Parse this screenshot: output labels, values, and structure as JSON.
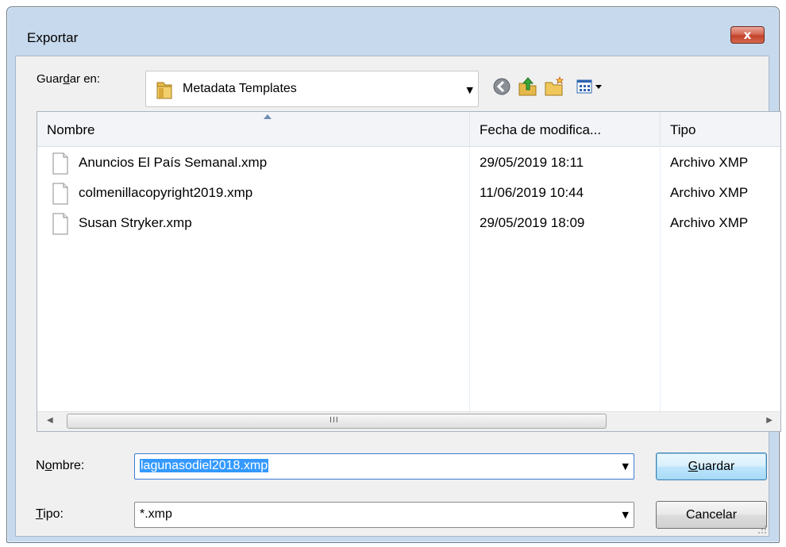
{
  "window": {
    "title": "Exportar",
    "close_label": "x"
  },
  "lookin": {
    "label_pre": "Guar",
    "label_u": "d",
    "label_post": "ar en:",
    "value": "Metadata Templates",
    "arrow": "▼"
  },
  "toolbar": {
    "icons": [
      "back-icon",
      "up-folder-icon",
      "new-folder-icon",
      "view-menu-icon"
    ]
  },
  "list": {
    "columns": [
      "Nombre",
      "Fecha de modifica...",
      "Tipo"
    ],
    "rows": [
      {
        "name": "Anuncios El País Semanal.xmp",
        "date": "29/05/2019 18:11",
        "type": "Archivo XMP"
      },
      {
        "name": "colmenillacopyright2019.xmp",
        "date": "11/06/2019 10:44",
        "type": "Archivo XMP"
      },
      {
        "name": "Susan Stryker.xmp",
        "date": "29/05/2019 18:09",
        "type": "Archivo XMP"
      }
    ],
    "scroll_left": "◀",
    "scroll_right": "▶",
    "scroll_grip": "III"
  },
  "filename": {
    "label_pre": "N",
    "label_u": "o",
    "label_post": "mbre:",
    "value": "lagunasodiel2018.xmp",
    "arrow": "▼"
  },
  "filetype": {
    "label_pre": "",
    "label_u": "T",
    "label_post": "ipo:",
    "value": "*.xmp",
    "arrow": "▼"
  },
  "buttons": {
    "save_pre": "",
    "save_u": "G",
    "save_post": "uardar",
    "cancel": "Cancelar"
  },
  "colors": {
    "selection": "#3399ff",
    "client_bg": "#f0f0f0",
    "frame": "#c7d9ec"
  }
}
